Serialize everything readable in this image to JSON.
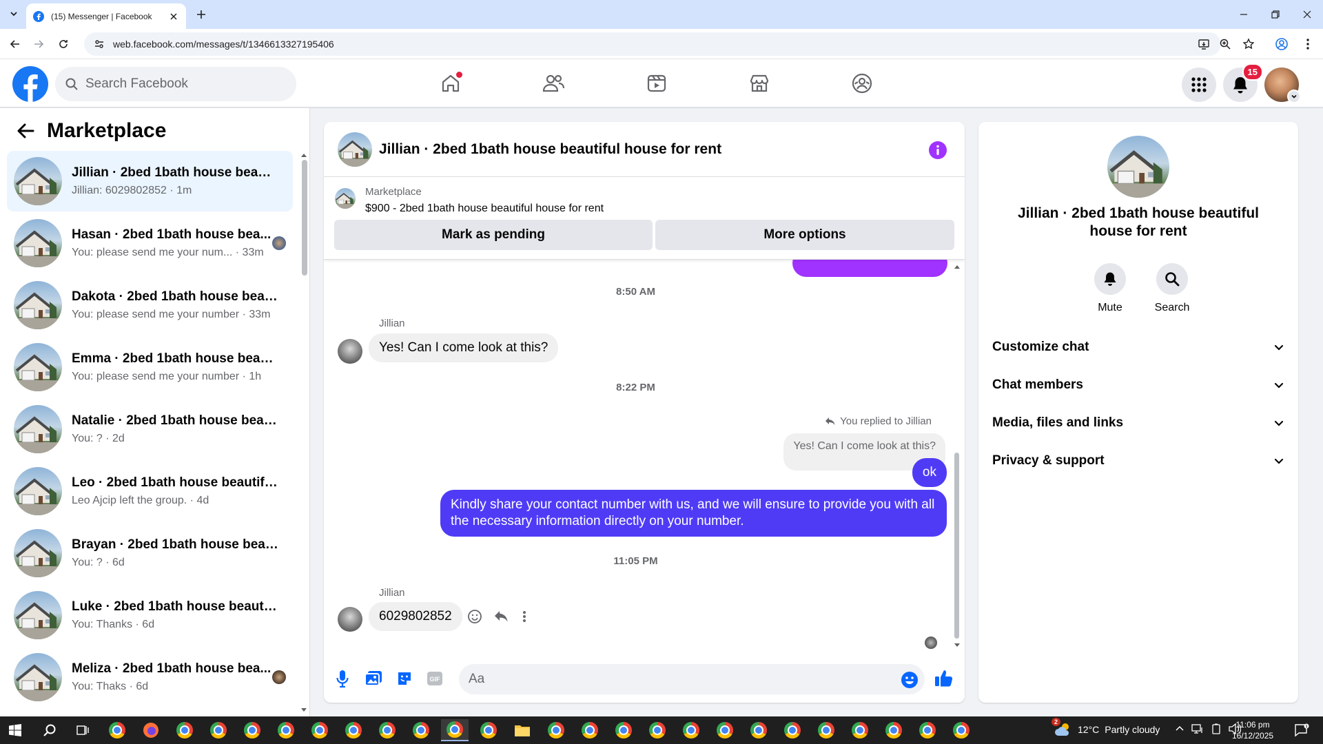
{
  "browser": {
    "tab_title": "(15) Messenger | Facebook",
    "url": "web.facebook.com/messages/t/1346613327195406"
  },
  "header": {
    "search_placeholder": "Search Facebook",
    "notification_count": "15",
    "brand_color": "#1877f2"
  },
  "sidebar": {
    "title": "Marketplace",
    "conversations": [
      {
        "name": "Jillian · 2bed 1bath house beautif...",
        "preview": "Jillian: 6029802852 · 1m",
        "active": true
      },
      {
        "name": "Hasan · 2bed 1bath house bea...",
        "preview": "You: please send me your num... · 33m"
      },
      {
        "name": "Dakota · 2bed 1bath house beaut...",
        "preview": "You: please send me your number · 33m"
      },
      {
        "name": "Emma · 2bed 1bath house beauti...",
        "preview": "You: please send me your number · 1h"
      },
      {
        "name": "Natalie · 2bed 1bath house beaut...",
        "preview": "You: ? · 2d"
      },
      {
        "name": "Leo · 2bed 1bath house beautiful...",
        "preview": "Leo Ajcip left the group. · 4d"
      },
      {
        "name": "Brayan · 2bed 1bath house beaut...",
        "preview": "You: ? · 6d"
      },
      {
        "name": "Luke · 2bed 1bath house beautif...",
        "preview": "You: Thanks · 6d"
      },
      {
        "name": "Meliza · 2bed 1bath house bea...",
        "preview": "You: Thaks · 6d"
      }
    ]
  },
  "chat": {
    "title": "Jillian · 2bed 1bath house beautiful house for rent",
    "marketplace_label": "Marketplace",
    "listing": "$900 - 2bed 1bath house beautiful house for rent",
    "mark_pending": "Mark as pending",
    "more_options": "More options",
    "time1": "8:50 AM",
    "sender1": "Jillian",
    "msg1": "Yes! Can I come look at this?",
    "time2": "8:22 PM",
    "reply_note": "You replied to Jillian",
    "quoted": "Yes! Can I come look at this?",
    "msg_ok": "ok",
    "msg_long": "Kindly share your contact number with us, and we will ensure to provide you with all the necessary information directly on your number.",
    "time3": "11:05 PM",
    "sender2": "Jillian",
    "msg_number": "6029802852",
    "composer_placeholder": "Aa",
    "outgoing_color": "#4f3bf6"
  },
  "details": {
    "name": "Jillian · 2bed 1bath house beautiful house for rent",
    "mute": "Mute",
    "search": "Search",
    "sections": [
      "Customize chat",
      "Chat members",
      "Media, files and links",
      "Privacy & support"
    ]
  },
  "taskbar": {
    "weather_temp": "12°C",
    "weather_text": "Partly cloudy",
    "weather_badge": "2",
    "time": "11:06 pm",
    "date": "16/12/2025"
  }
}
